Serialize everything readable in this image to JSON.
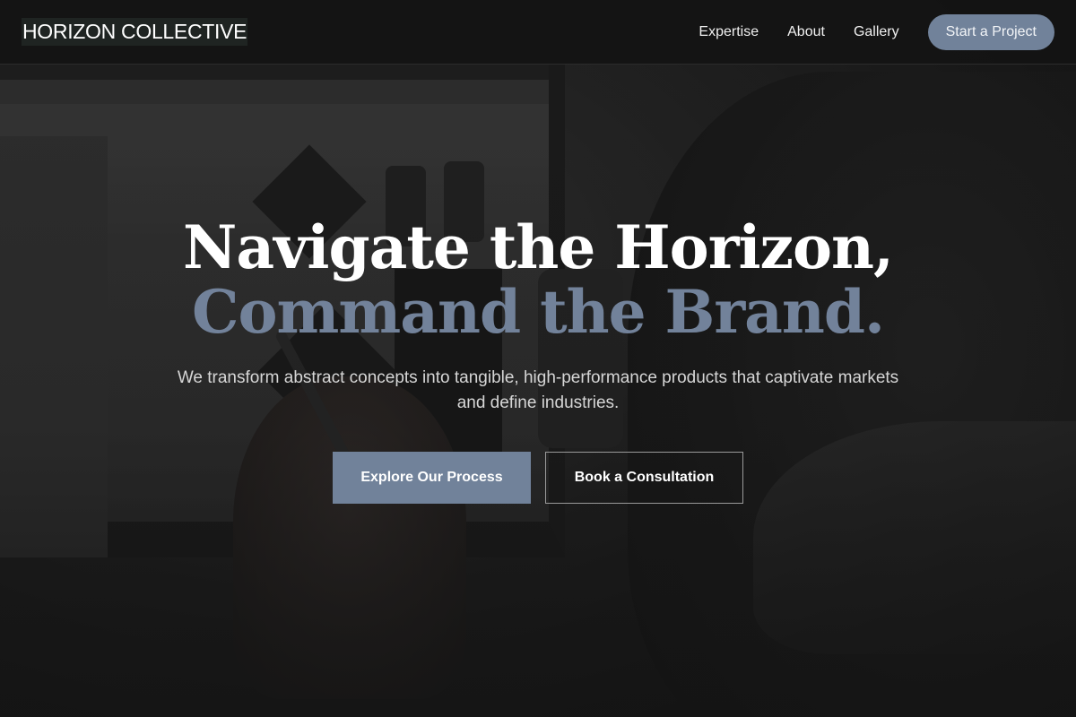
{
  "header": {
    "logo": "HORIZON COLLECTIVE",
    "nav": [
      {
        "label": "Expertise"
      },
      {
        "label": "About"
      },
      {
        "label": "Gallery"
      }
    ],
    "cta_label": "Start a Project"
  },
  "hero": {
    "title_line1": "Navigate the Horizon,",
    "title_line2": "Command the Brand.",
    "subtitle": "We transform abstract concepts into tangible, high-performance products that captivate markets and define industries.",
    "primary_button": "Explore Our Process",
    "secondary_button": "Book a Consultation"
  },
  "colors": {
    "accent": "#71829a",
    "background": "#141414",
    "text": "#ffffff"
  }
}
